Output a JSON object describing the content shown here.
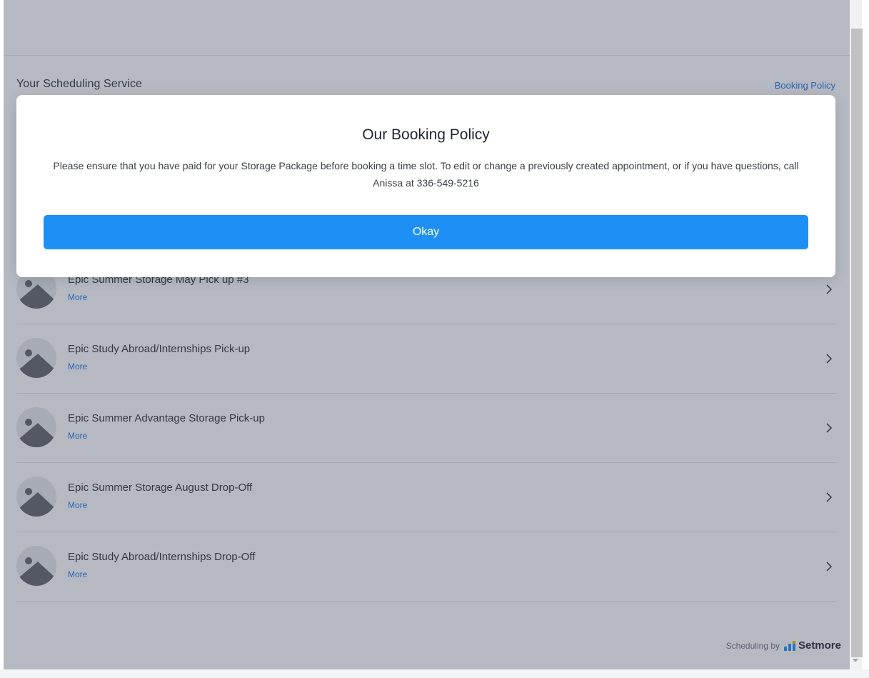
{
  "header": {
    "service_title": "Your Scheduling Service",
    "policy_link": "Booking Policy"
  },
  "services": [
    {
      "title": "Epic Summer Storage May Pick up #3",
      "more": "More"
    },
    {
      "title": "Epic Study Abroad/Internships Pick-up",
      "more": "More"
    },
    {
      "title": "Epic Summer Advantage Storage Pick-up",
      "more": "More"
    },
    {
      "title": "Epic Summer Storage August Drop-Off",
      "more": "More"
    },
    {
      "title": "Epic Study Abroad/Internships Drop-Off",
      "more": "More"
    }
  ],
  "modal": {
    "title": "Our Booking Policy",
    "body": "Please ensure that you have paid for your Storage Package before booking a time slot. To edit or change a previously created appointment, or if you have questions, call Anissa at 336-549-5216",
    "button_label": "Okay"
  },
  "footer": {
    "scheduling_by": "Scheduling by",
    "brand": "Setmore"
  },
  "colors": {
    "accent": "#1e90f5",
    "link": "#1a73e8",
    "overlay": "#3e485e"
  },
  "icons": {
    "service_thumb": "image-placeholder-icon",
    "row_chevron": "chevron-right-icon",
    "brand_logo": "setmore-logo-icon"
  }
}
